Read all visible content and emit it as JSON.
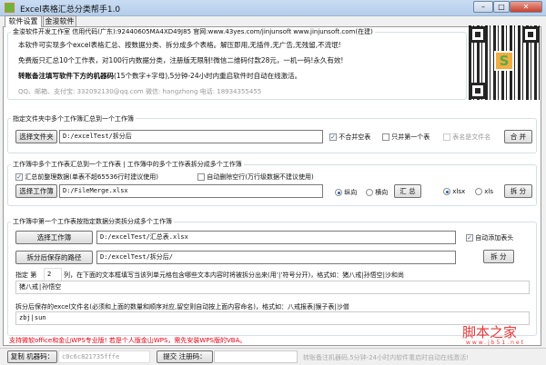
{
  "window": {
    "title": "Excel表格汇总分类帮手1.0"
  },
  "tabs": [
    {
      "label": "软件设置"
    },
    {
      "label": "金浚软件"
    }
  ],
  "info": {
    "header": "金浚软件开发工作室 信用代码(广东):92440605MA4XD49J85 官网:www.43yes.com/jinjunsoft  www.jinjunsoft.com(在建)",
    "line1": "本软件可实现多个excel表格汇总、按数据分类、拆分成多个表格。解压即用,无插件,无广告,无残留,不流氓!",
    "line2": "免费版只汇总10个工作表，对100行内数据分类，注册版无限制!微信二维码付款28元，一机一码!永久有效!",
    "line3_bold": "转账备注填写软件下方的机器码",
    "line3_rest": "(15个数字+字母),5分钟-24小时内重启软件时自动在线激活。",
    "contact": "QQ、邮箱、支付宝: 332092130@qq.com    微信: hangzhong    电话: 18934355455"
  },
  "group1": {
    "title": "指定文件夹中多个工作簿汇总到一个工作簿",
    "select_folder": "选择文件夹",
    "path": "D:/excelTest/拆分后",
    "skip_empty": {
      "label": "不合并空表",
      "checked": true
    },
    "first_only": {
      "label": "只并第一个表",
      "checked": false
    },
    "sheet_filename": {
      "label": "表名是文件名",
      "checked": false
    },
    "merge": "合 并"
  },
  "group2": {
    "title": "工作簿中多个工作表汇总到一个工作表 | 工作簿中的多个工作表拆分成多个工作簿",
    "tidy": {
      "label": "汇总前整理数据(单表不超65536行时建议使用)",
      "checked": true
    },
    "delete_blank": {
      "label": "自动删除空行(万行级数据不建议使用)",
      "checked": false
    },
    "select_wb": "选择工作簿",
    "path": "D:/FileMerge.xlsx",
    "vertical": {
      "label": "纵向",
      "checked": true
    },
    "horizontal": {
      "label": "横向",
      "checked": false
    },
    "summary": "汇 总",
    "xlsx": {
      "label": "xlsx",
      "checked": true
    },
    "xls": {
      "label": "xls",
      "checked": false
    },
    "split": "拆 分"
  },
  "group3": {
    "title": "工作簿中第一个工作表按指定数据分类拆分成多个工作簿",
    "select_wb": "选择工作簿",
    "wb_path": "D:/excelTest/汇总表.xlsx",
    "auto_header": {
      "label": "自动添加表头",
      "checked": true
    },
    "save_path_btn": "拆分后保存的路径",
    "save_path": "D:/excelTest/拆分后/",
    "split": "拆 分",
    "col_prefix": "指定 第",
    "col_value": "2",
    "col_suffix": "列，在下面的文本框填写当该列单元格包含哪些文本内容时将被拆分出来(用‘|’符号分开)，格式如：猪八戒|孙悟空|沙和尚",
    "keywords": "猪八戒|孙悟空",
    "filename_label": "拆分后保存的excel文件名(必须和上面的数量和顺序对应,留空则自动按上面内容命名)，格式如：八戒报表|猴子表|沙僧",
    "filenames": "zbj|sun"
  },
  "notice": "支持微软office和金山WPS专业版! 若是个人版金山WPS，需先安装WPS版的VBA。",
  "watermark": {
    "title": "脚本之家",
    "url": "www.jb51.net"
  },
  "status": {
    "copy_btn": "复制 机器码：",
    "machine_code": "c0c6c821735fffe",
    "submit_btn": "提交 注册码：",
    "reg_code": "",
    "hint": "转账备注机器码,5分钟-24小时内软件重启时自动在线激活!"
  },
  "colors": {
    "notice": "#e60012",
    "watermark": "#e23a3a"
  }
}
